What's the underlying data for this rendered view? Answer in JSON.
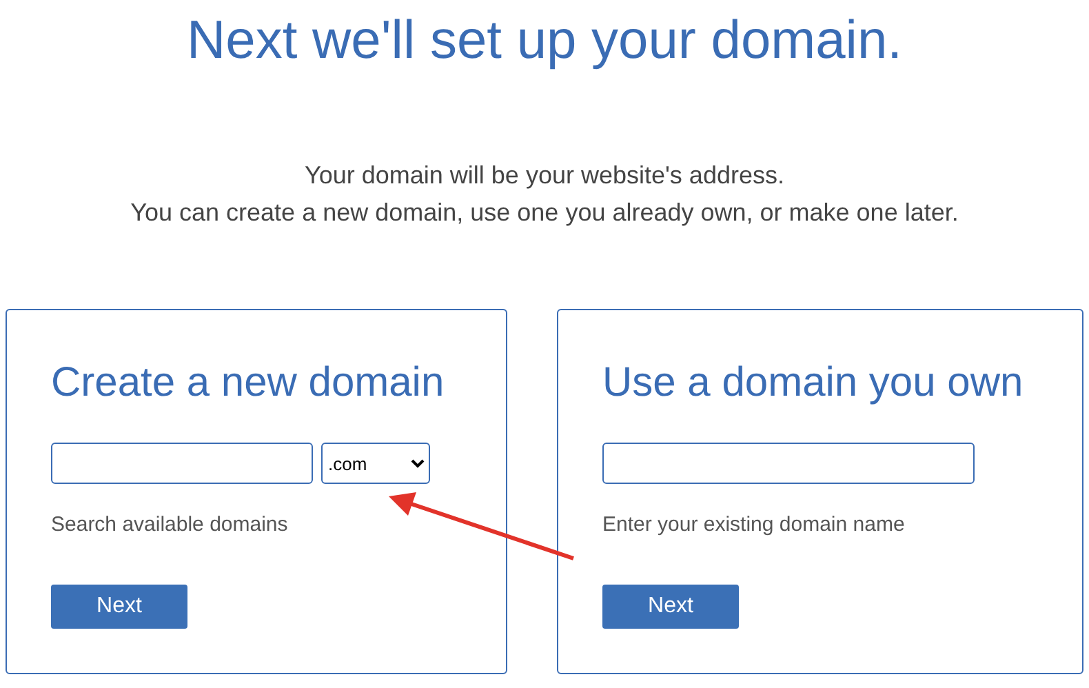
{
  "heading": "Next we'll set up your domain.",
  "intro": [
    "Your domain will be your website's address.",
    "You can create a new domain, use one you already own, or make one later."
  ],
  "cards": [
    {
      "title": "Create a new domain",
      "tld": {
        "value": ".com"
      },
      "hint": "Search available domains",
      "button": "Next"
    },
    {
      "title": "Use a domain you own",
      "hint": "Enter your existing domain name",
      "button": "Next"
    }
  ]
}
